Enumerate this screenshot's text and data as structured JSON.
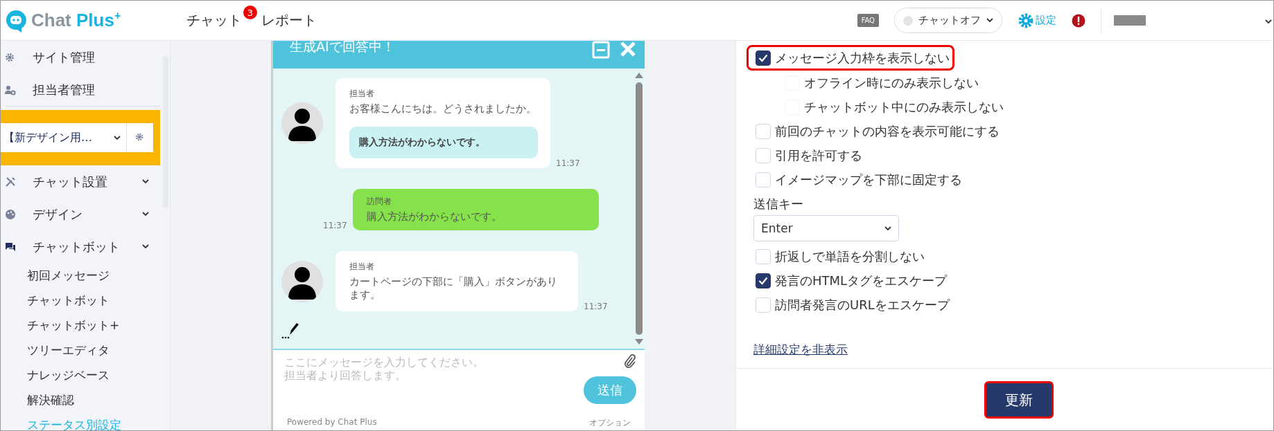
{
  "header": {
    "logo": {
      "word": "Chat",
      "accent": "Plus",
      "mark": "+"
    },
    "nav": [
      {
        "label": "チャット",
        "badge": "3"
      },
      {
        "label": "レポート"
      }
    ],
    "faq": "FAQ",
    "status": {
      "label": "チャットオフ",
      "online": false
    },
    "settings": "設定"
  },
  "sidebar": {
    "admin_items": [
      {
        "label": "サイト管理"
      },
      {
        "label": "担当者管理"
      }
    ],
    "site_select": {
      "value": "【新デザイン用…"
    },
    "sections": [
      {
        "label": "チャット設置"
      },
      {
        "label": "デザイン"
      },
      {
        "label": "チャットボット",
        "children": [
          {
            "label": "初回メッセージ",
            "selected": false
          },
          {
            "label": "チャットボット",
            "selected": false
          },
          {
            "label": "チャットボット+",
            "selected": false
          },
          {
            "label": "ツリーエディタ",
            "selected": false
          },
          {
            "label": "ナレッジベース",
            "selected": false
          },
          {
            "label": "解決確認",
            "selected": false
          },
          {
            "label": "ステータス別設定",
            "selected": true
          }
        ]
      }
    ]
  },
  "chat_preview": {
    "title": "生成AIで回答中！",
    "messages": [
      {
        "kind": "agent",
        "sender": "担当者",
        "text": "お客様こんにちは。どうされましたか。",
        "option": "購入方法がわからないです。",
        "time": "11:37"
      },
      {
        "kind": "visitor",
        "sender": "訪問者",
        "text": "購入方法がわからないです。",
        "time": "11:37"
      },
      {
        "kind": "agent",
        "sender": "担当者",
        "text": "カートページの下部に「購入」ボタンがあります。",
        "time": "11:37"
      }
    ],
    "typing": true,
    "input": {
      "placeholder": "ここにメッセージを入力してください。担当者より回答します。"
    },
    "send": "送信",
    "powered_by": "Powered by Chat Plus",
    "options": "オプション"
  },
  "settings": {
    "options": [
      {
        "kind": "checkbox",
        "label": "メッセージ入力枠を表示しない",
        "checked": true,
        "disabled": false,
        "highlighted": true,
        "children": [
          {
            "kind": "checkbox",
            "label": "オフライン時にのみ表示しない",
            "checked": false,
            "disabled": true
          },
          {
            "kind": "checkbox",
            "label": "チャットボット中にのみ表示しない",
            "checked": false,
            "disabled": true
          }
        ]
      },
      {
        "kind": "checkbox",
        "label": "前回のチャットの内容を表示可能にする",
        "checked": false,
        "disabled": false
      },
      {
        "kind": "checkbox",
        "label": "引用を許可する",
        "checked": false,
        "disabled": false
      },
      {
        "kind": "checkbox",
        "label": "イメージマップを下部に固定する",
        "checked": false,
        "disabled": false
      },
      {
        "kind": "select",
        "label": "送信キー",
        "value": "Enter"
      },
      {
        "kind": "checkbox",
        "label": "折返しで単語を分割しない",
        "checked": false,
        "disabled": false
      },
      {
        "kind": "checkbox",
        "label": "発言のHTMLタグをエスケープ",
        "checked": true,
        "disabled": false
      },
      {
        "kind": "checkbox",
        "label": "訪問者発言のURLをエスケープ",
        "checked": false,
        "disabled": false
      }
    ],
    "toggle_link": "詳細設定を非表示",
    "update_button": {
      "label": "更新",
      "highlighted": true
    }
  }
}
